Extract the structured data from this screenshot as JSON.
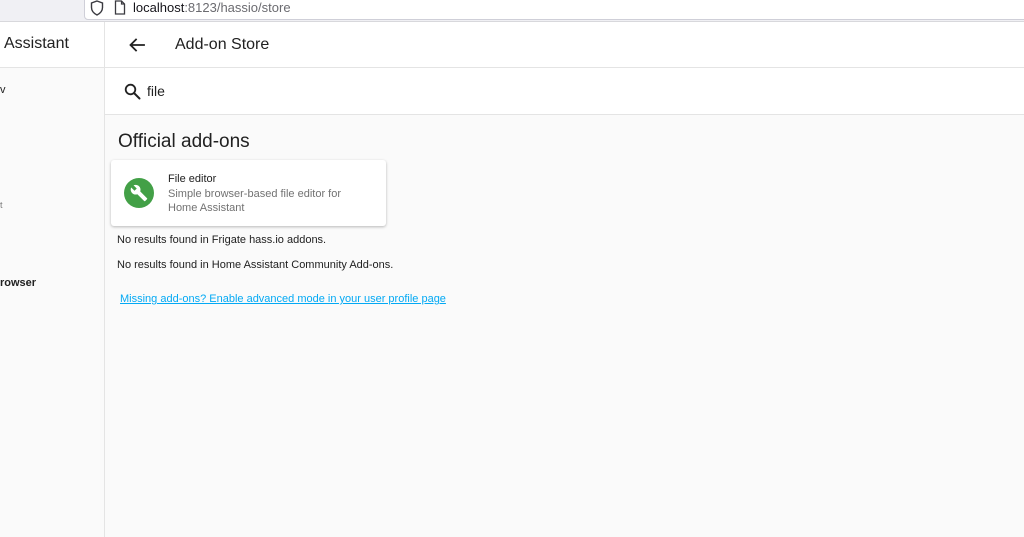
{
  "browser": {
    "url_host": "localhost",
    "url_path": ":8123/hassio/store"
  },
  "sidebar": {
    "title": "Assistant",
    "fragments": [
      "v",
      "t",
      "rowser"
    ]
  },
  "toolbar": {
    "title": "Add-on Store"
  },
  "search": {
    "value": "file"
  },
  "section": {
    "title": "Official add-ons"
  },
  "addon": {
    "name": "File editor",
    "description": "Simple browser-based file editor for Home Assistant",
    "icon": "wrench-icon",
    "icon_color": "#43a047"
  },
  "messages": {
    "frigate": "No results found in Frigate hass.io addons.",
    "community": "No results found in Home Assistant Community Add-ons."
  },
  "link": {
    "advanced_mode": "Missing add-ons? Enable advanced mode in your user profile page"
  },
  "colors": {
    "link": "#03a9f4",
    "background": "#fafafa"
  }
}
